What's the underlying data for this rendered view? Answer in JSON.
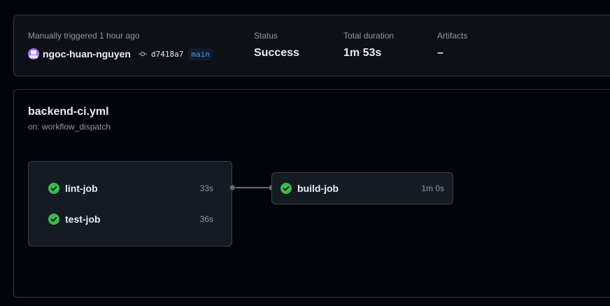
{
  "summary": {
    "trigger_text": "Manually triggered 1 hour ago",
    "actor": "ngoc-huan-nguyen",
    "commit_sha": "d7418a7",
    "branch": "main",
    "status_label": "Status",
    "status_value": "Success",
    "duration_label": "Total duration",
    "duration_value": "1m 53s",
    "artifacts_label": "Artifacts",
    "artifacts_value": "–"
  },
  "workflow": {
    "filename": "backend-ci.yml",
    "trigger": "on: workflow_dispatch",
    "group_jobs": [
      {
        "name": "lint-job",
        "duration": "33s",
        "status": "success"
      },
      {
        "name": "test-job",
        "duration": "36s",
        "status": "success"
      }
    ],
    "downstream_job": {
      "name": "build-job",
      "duration": "1m 0s",
      "status": "success"
    }
  },
  "colors": {
    "success": "#3fb950",
    "accent": "#4493f8",
    "avatar": "#a371f7"
  },
  "icons": {
    "status": "check-circle-fill-icon",
    "commit": "git-commit-icon"
  }
}
